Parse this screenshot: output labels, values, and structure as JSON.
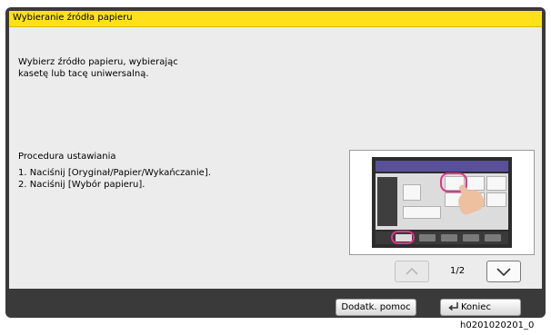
{
  "dialog": {
    "title": "Wybieranie źródła papieru",
    "description_lines": [
      "Wybierz źródło papieru, wybierając",
      "kasetę lub tacę uniwersalną."
    ],
    "procedure_heading": "Procedura ustawiania",
    "steps": [
      "1. Naciśnij [Oryginał/Papier/Wykańczanie].",
      "2. Naciśnij [Wybór papieru]."
    ]
  },
  "pager": {
    "indicator": "1/2",
    "up_icon": "chevron-up-icon",
    "down_icon": "chevron-down-icon"
  },
  "footer": {
    "help_label": "Dodatk. pomoc",
    "end_label": "Koniec",
    "end_icon": "enter-arrow-icon"
  },
  "document_id": "h0201020201_0",
  "colors": {
    "title_bar": "#ffe11a",
    "frame": "#3a3a3a",
    "content_bg": "#ececec",
    "highlight": "#e0348c"
  }
}
